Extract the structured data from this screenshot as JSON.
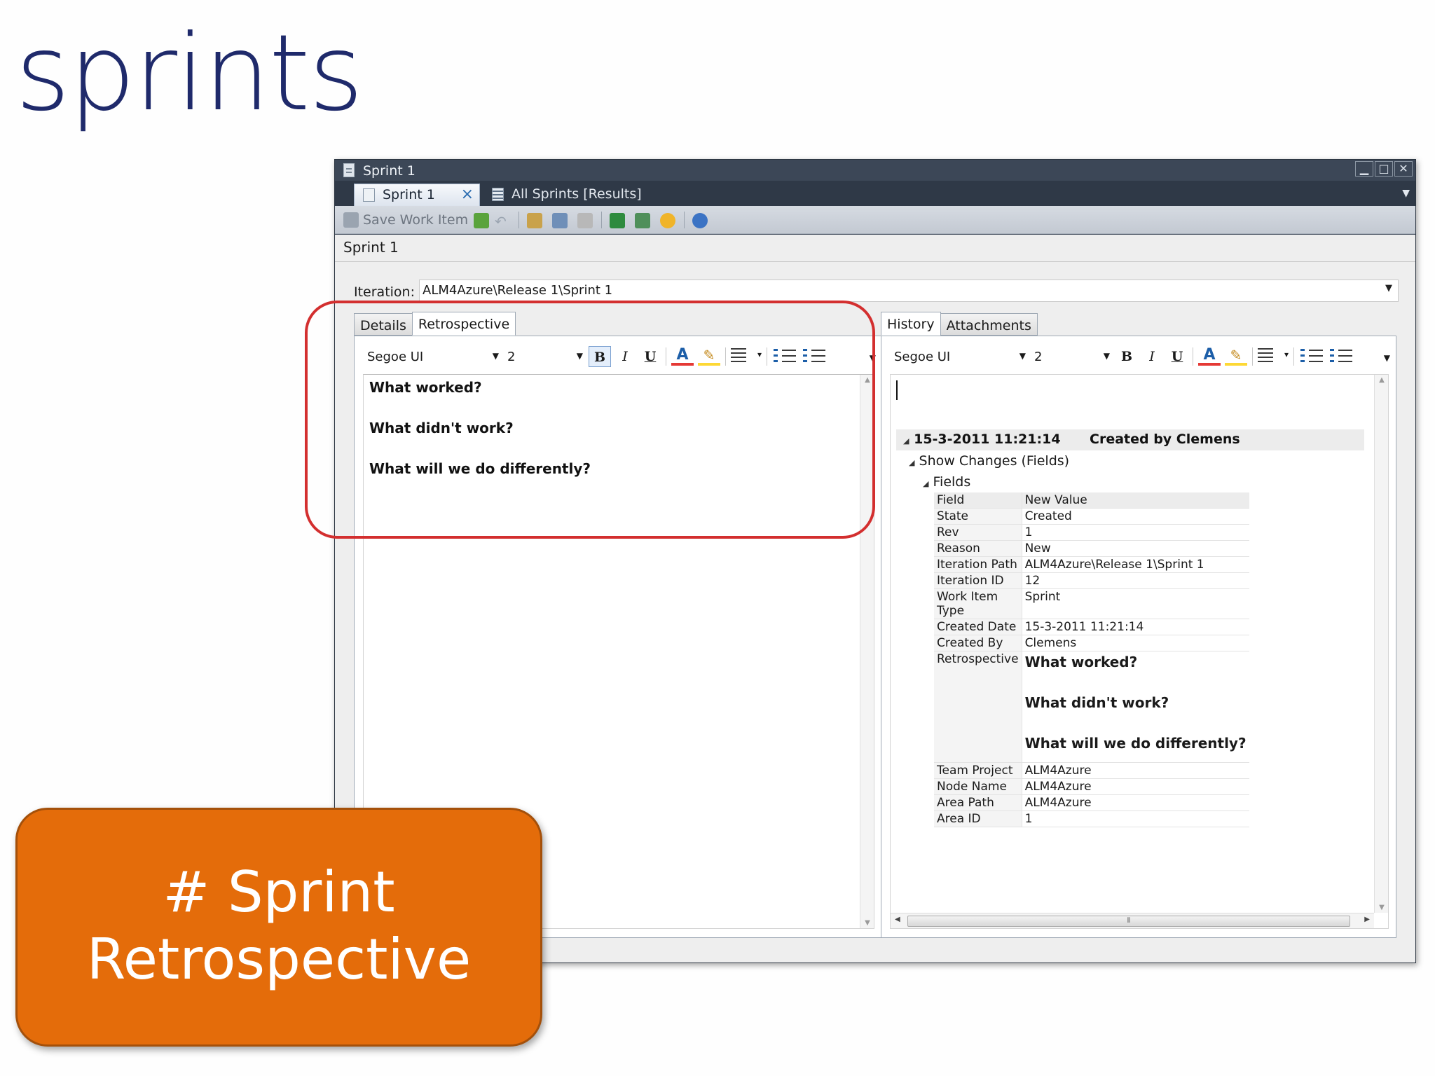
{
  "slide": {
    "title": "sprints"
  },
  "window": {
    "title": "Sprint 1",
    "controls": [
      "minimize-icon",
      "maximize-icon",
      "close-icon"
    ],
    "tabs": [
      {
        "label": "Sprint 1",
        "active": true
      },
      {
        "label": "All Sprints [Results]",
        "active": false
      }
    ],
    "toolbar": {
      "save_label": "Save Work Item"
    },
    "work_item_title": "Sprint 1",
    "iteration": {
      "label": "Iteration:",
      "value": "ALM4Azure\\Release 1\\Sprint 1"
    }
  },
  "left_pane": {
    "tabs": [
      "Details",
      "Retrospective"
    ],
    "active_tab": "Retrospective",
    "editor": {
      "font": "Segoe UI",
      "size": "2"
    },
    "lines": [
      "What worked?",
      "What didn't work?",
      "What will we do differently?"
    ]
  },
  "right_pane": {
    "tabs": [
      "History",
      "Attachments"
    ],
    "active_tab": "History",
    "editor": {
      "font": "Segoe UI",
      "size": "2"
    },
    "entry": {
      "date": "15-3-2011 11:21:14",
      "created_by": "Created by Clemens",
      "show_changes": "Show Changes (Fields)",
      "fields_label": "Fields",
      "header": {
        "field": "Field",
        "value": "New Value"
      },
      "rows": [
        {
          "field": "State",
          "value": "Created"
        },
        {
          "field": "Rev",
          "value": "1"
        },
        {
          "field": "Reason",
          "value": "New"
        },
        {
          "field": "Iteration Path",
          "value": "ALM4Azure\\Release 1\\Sprint 1"
        },
        {
          "field": "Iteration ID",
          "value": "12"
        },
        {
          "field": "Work Item Type",
          "value": "Sprint"
        },
        {
          "field": "Created Date",
          "value": "15-3-2011 11:21:14"
        },
        {
          "field": "Created By",
          "value": "Clemens"
        }
      ],
      "retrospective": {
        "field": "Retrospective",
        "lines": [
          "What worked?",
          "What didn't work?",
          "What will we do differently?"
        ]
      },
      "rows_after": [
        {
          "field": "Team Project",
          "value": "ALM4Azure"
        },
        {
          "field": "Node Name",
          "value": "ALM4Azure"
        },
        {
          "field": "Area Path",
          "value": "ALM4Azure"
        },
        {
          "field": "Area ID",
          "value": "1"
        }
      ]
    }
  },
  "callout": {
    "line1": "# Sprint",
    "line2": "Retrospective",
    "color": "#e46c0a"
  },
  "highlight_color": "#d32f2f"
}
